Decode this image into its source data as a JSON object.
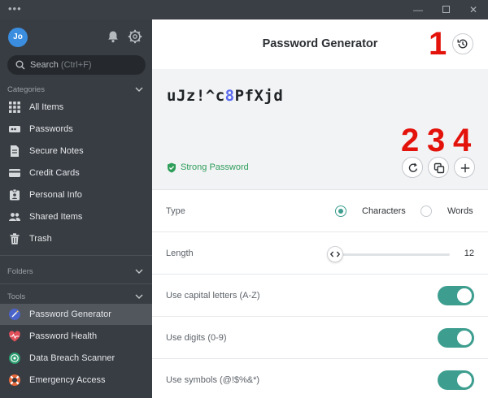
{
  "window": {
    "menu": "•••",
    "minimize": "—",
    "close": "✕"
  },
  "user": {
    "initials": "Jo"
  },
  "search": {
    "placeholder": "Search",
    "shortcut": "(Ctrl+F)"
  },
  "sidebar": {
    "categories_heading": "Categories",
    "categories": [
      {
        "label": "All Items",
        "icon": "grid-icon"
      },
      {
        "label": "Passwords",
        "icon": "password-icon"
      },
      {
        "label": "Secure Notes",
        "icon": "note-icon"
      },
      {
        "label": "Credit Cards",
        "icon": "credit-card-icon"
      },
      {
        "label": "Personal Info",
        "icon": "id-card-icon"
      },
      {
        "label": "Shared Items",
        "icon": "people-icon"
      },
      {
        "label": "Trash",
        "icon": "trash-icon"
      }
    ],
    "folders_heading": "Folders",
    "tools_heading": "Tools",
    "tools": [
      {
        "label": "Password Generator",
        "icon": "generator-icon",
        "active": true
      },
      {
        "label": "Password Health",
        "icon": "heart-pulse-icon"
      },
      {
        "label": "Data Breach Scanner",
        "icon": "scanner-icon"
      },
      {
        "label": "Emergency Access",
        "icon": "lifebuoy-icon"
      }
    ]
  },
  "main": {
    "title": "Password Generator",
    "password": {
      "before": "uJz!^c",
      "digit": "8",
      "after": "PfXjd"
    },
    "strength": "Strong Password",
    "annotations": [
      "1",
      "2",
      "3",
      "4"
    ],
    "options": {
      "type_label": "Type",
      "type_characters": "Characters",
      "type_words": "Words",
      "type_selected": "Characters",
      "length_label": "Length",
      "length_value": "12",
      "capitals_label": "Use capital letters (A-Z)",
      "capitals_on": true,
      "digits_label": "Use digits (0-9)",
      "digits_on": true,
      "symbols_label": "Use symbols (@!$%&*)",
      "symbols_on": true
    }
  },
  "colors": {
    "accent": "#3d9e8f",
    "strength_green": "#2f9e5a",
    "annotation_red": "#e3120b",
    "digit_blue": "#5b6cf0",
    "sidebar_bg": "#383d43"
  }
}
